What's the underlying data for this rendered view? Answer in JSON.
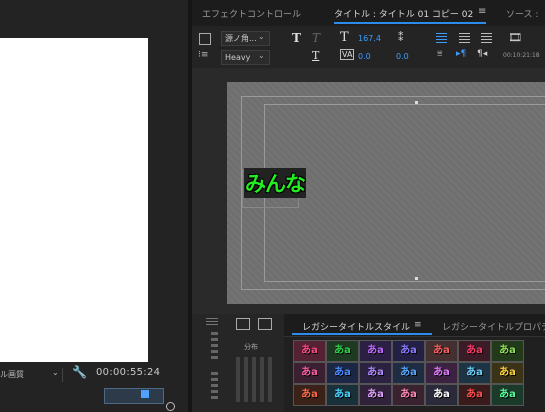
{
  "tabs": {
    "effect_controls": "エフェクトコントロール",
    "title_tab": "タイトル : タイトル 01 コピー 02",
    "menu": "≡",
    "source": "ソース :"
  },
  "toolbar": {
    "font_name": "源ノ角...",
    "font_style": "Heavy",
    "font_size": "167.4",
    "kerning": "0.0",
    "tracking": "0.0",
    "timecode_small": "00:10:21:18"
  },
  "canvas": {
    "title_text": "みんな"
  },
  "program_monitor": {
    "quality": "ル画質",
    "timecode": "00:00:55:24"
  },
  "align_panel": {
    "distribute_label": "分布"
  },
  "styles_panel": {
    "legacy_styles_tab": "レガシータイトルスタイル",
    "menu": "≡",
    "legacy_props_tab": "レガシータイトルプロパテ",
    "swatch_text": "あa",
    "swatches": [
      {
        "fg": "#ff4a8a",
        "bg": "#552233"
      },
      {
        "fg": "#2fd34a",
        "bg": "#1f3a22"
      },
      {
        "fg": "#c06bff",
        "bg": "#2c1f44"
      },
      {
        "fg": "#8a7cff",
        "bg": "#241f44"
      },
      {
        "fg": "#ff5f5f",
        "bg": "#443030"
      },
      {
        "fg": "#ff3b6a",
        "bg": "#3a1b26"
      },
      {
        "fg": "#8fe35a",
        "bg": "#223a1a"
      },
      {
        "fg": "#33e3c5",
        "bg": "#183a36"
      },
      {
        "fg": "#ff5ea8",
        "bg": "#3a2030"
      },
      {
        "fg": "#4a8cff",
        "bg": "#1b2744"
      },
      {
        "fg": "#b08cff",
        "bg": "#2a2240"
      },
      {
        "fg": "#5aa8ff",
        "bg": "#1e2d44"
      },
      {
        "fg": "#e07cff",
        "bg": "#3a2240"
      },
      {
        "fg": "#6fd0ff",
        "bg": "#1d3444"
      },
      {
        "fg": "#ffd23f",
        "bg": "#3a3318"
      },
      {
        "fg": "#6aff7a",
        "bg": "#1e3a24"
      },
      {
        "fg": "#ff6b4a",
        "bg": "#3a2218"
      },
      {
        "fg": "#4cd1ff",
        "bg": "#18303a"
      },
      {
        "fg": "#e0a0ff",
        "bg": "#30223a"
      },
      {
        "fg": "#ff8ab3",
        "bg": "#3a2230"
      },
      {
        "fg": "#ffffff",
        "bg": "#2a2a3a"
      },
      {
        "fg": "#ff5050",
        "bg": "#3a1a1a"
      },
      {
        "fg": "#58ff9a",
        "bg": "#1a3a2a"
      },
      {
        "fg": "#5ab0ff",
        "bg": "#1a2a3a"
      }
    ]
  }
}
